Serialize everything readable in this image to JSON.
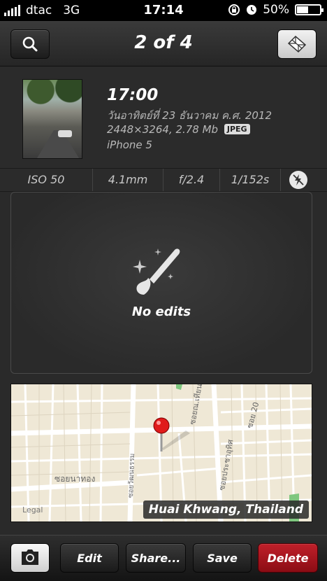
{
  "status_bar": {
    "carrier": "dtac",
    "network": "3G",
    "time": "17:14",
    "battery": "50%",
    "battery_level": 0.5
  },
  "nav": {
    "title": "2 of 4",
    "left_icon": "search-icon",
    "right_icon": "map-fold-icon"
  },
  "photo": {
    "time": "17:00",
    "date": "วันอาทิตย์ที่ 23 ธันวาคม ค.ศ. 2012",
    "dimensions_size": "2448×3264, 2.78 Mb",
    "format": "JPEG",
    "device": "iPhone 5"
  },
  "exif": {
    "iso": "ISO 50",
    "focal_length": "4.1mm",
    "aperture": "f/2.4",
    "shutter": "1/152s",
    "flash_icon": "flash-off-icon"
  },
  "edits": {
    "icon": "brush-sparkle-icon",
    "label": "No edits"
  },
  "map": {
    "location": "Huai Khwang, Thailand",
    "legal": "Legal",
    "street_labels": [
      "ซอยนาทอง",
      "ซอยณ.เทียนชัย",
      "ซอยประชาอุทิศ",
      "ซอยวัฒนธรรม",
      "ซอย 20"
    ]
  },
  "toolbar": {
    "camera_icon": "camera-icon",
    "edit": "Edit",
    "share": "Share...",
    "save": "Save",
    "delete": "Delete"
  },
  "colors": {
    "delete_red": "#a81520",
    "background": "#2a2a2a",
    "map_background": "#efe8d6",
    "pin_red": "#e01b1b"
  }
}
